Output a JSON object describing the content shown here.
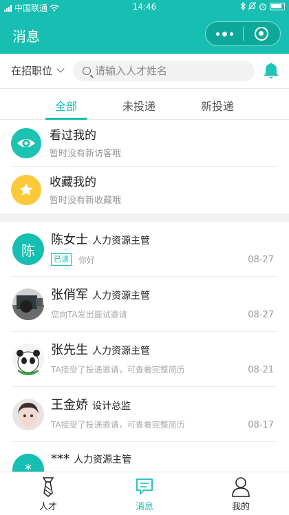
{
  "status_bar": {
    "carrier": "中国联通",
    "time": "14:46"
  },
  "nav": {
    "title": "消息"
  },
  "filter": {
    "position_label": "在招职位",
    "search_placeholder": "请输入人才姓名"
  },
  "tabs": [
    "全部",
    "未投递",
    "新投递"
  ],
  "active_tab": 0,
  "notices": [
    {
      "title": "看过我的",
      "subtitle": "暂时没有新访客哦",
      "icon": "eye-icon",
      "color": "#1cc2b2"
    },
    {
      "title": "收藏我的",
      "subtitle": "暂时没有新收藏哦",
      "icon": "star-icon",
      "color": "#fcc93a"
    }
  ],
  "chats": [
    {
      "name": "陈女士",
      "role": "人力资源主管",
      "badge": "已读",
      "message": "你好",
      "date": "08-27",
      "avatar_text": "陈"
    },
    {
      "name": "张俏军",
      "role": "人力资源主管",
      "badge": "",
      "message": "您向TA发出面试邀请",
      "date": "08-27",
      "avatar_text": ""
    },
    {
      "name": "张先生",
      "role": "人力资源主管",
      "badge": "",
      "message": "TA接受了投递邀请，可查看完整简历",
      "date": "08-21",
      "avatar_text": ""
    },
    {
      "name": "王金娇",
      "role": "设计总监",
      "badge": "",
      "message": "TA接受了投递邀请，可查看完整简历",
      "date": "08-17",
      "avatar_text": ""
    },
    {
      "name": "***",
      "role": "人力资源主管",
      "badge": "",
      "message": "",
      "date": "",
      "avatar_text": "*"
    }
  ],
  "tabbar": [
    {
      "label": "人才",
      "icon": "tie-icon"
    },
    {
      "label": "消息",
      "icon": "message-icon"
    },
    {
      "label": "我的",
      "icon": "person-icon"
    }
  ],
  "colors": {
    "accent": "#16bfb1",
    "notice_eye": "#1cc2b2",
    "notice_star": "#fcc93a"
  }
}
